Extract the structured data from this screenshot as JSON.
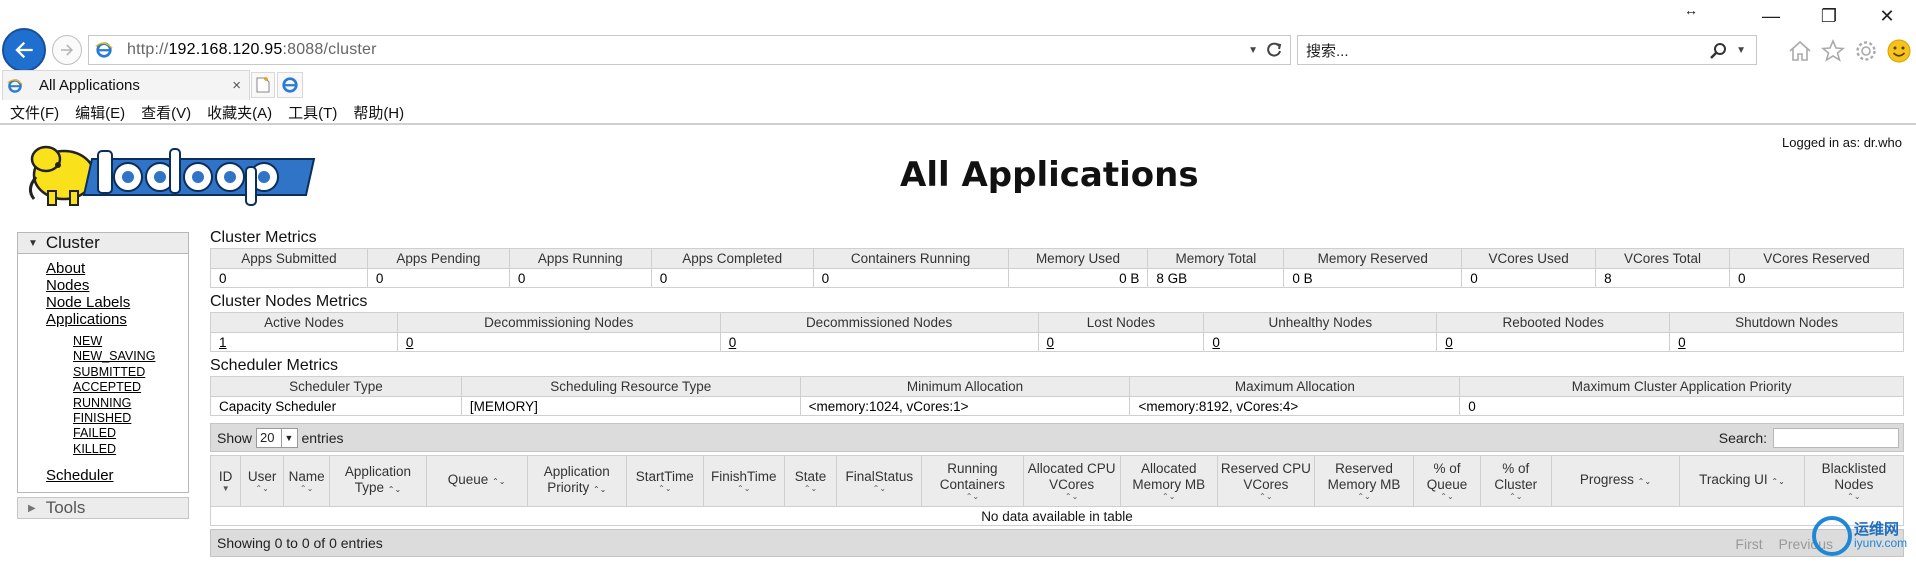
{
  "browser": {
    "url_prefix": "http://",
    "url_host": "192.168.120.95",
    "url_rest": ":8088/cluster",
    "search_placeholder": "搜索...",
    "tab_title": "All Applications",
    "tab_close": "×",
    "menu": [
      "文件(F)",
      "编辑(E)",
      "查看(V)",
      "收藏夹(A)",
      "工具(T)",
      "帮助(H)"
    ],
    "window_controls": {
      "minimize": "—",
      "restore": "❐",
      "close": "✕"
    }
  },
  "header": {
    "logged_in": "Logged in as: dr.who",
    "title": "All Applications"
  },
  "nav": {
    "cluster_label": "Cluster",
    "cluster_links": [
      "About",
      "Nodes",
      "Node Labels",
      "Applications"
    ],
    "app_states": [
      "NEW",
      "NEW_SAVING",
      "SUBMITTED",
      "ACCEPTED",
      "RUNNING",
      "FINISHED",
      "FAILED",
      "KILLED"
    ],
    "scheduler_link": "Scheduler",
    "tools_label": "Tools"
  },
  "cluster_metrics": {
    "title": "Cluster Metrics",
    "headers": [
      "Apps Submitted",
      "Apps Pending",
      "Apps Running",
      "Apps Completed",
      "Containers Running",
      "Memory Used",
      "Memory Total",
      "Memory Reserved",
      "VCores Used",
      "VCores Total",
      "VCores Reserved"
    ],
    "values": [
      "0",
      "0",
      "0",
      "0",
      "0",
      "0 B",
      "8 GB",
      "0 B",
      "0",
      "8",
      "0"
    ]
  },
  "nodes_metrics": {
    "title": "Cluster Nodes Metrics",
    "headers": [
      "Active Nodes",
      "Decommissioning Nodes",
      "Decommissioned Nodes",
      "Lost Nodes",
      "Unhealthy Nodes",
      "Rebooted Nodes",
      "Shutdown Nodes"
    ],
    "values": [
      "1",
      "0",
      "0",
      "0",
      "0",
      "0",
      "0"
    ]
  },
  "scheduler_metrics": {
    "title": "Scheduler Metrics",
    "headers": [
      "Scheduler Type",
      "Scheduling Resource Type",
      "Minimum Allocation",
      "Maximum Allocation",
      "Maximum Cluster Application Priority"
    ],
    "values": [
      "Capacity Scheduler",
      "[MEMORY]",
      "<memory:1024, vCores:1>",
      "<memory:8192, vCores:4>",
      "0"
    ]
  },
  "apps_table": {
    "show_label": "Show",
    "page_size": "20",
    "entries_label": "entries",
    "search_label": "Search:",
    "headers": [
      "ID",
      "User",
      "Name",
      "Application Type",
      "Queue",
      "Application Priority",
      "StartTime",
      "FinishTime",
      "State",
      "FinalStatus",
      "Running Containers",
      "Allocated CPU VCores",
      "Allocated Memory MB",
      "Reserved CPU VCores",
      "Reserved Memory MB",
      "% of Queue",
      "% of Cluster",
      "Progress",
      "Tracking UI",
      "Blacklisted Nodes"
    ],
    "empty_text": "No data available in table",
    "footer_text": "Showing 0 to 0 of 0 entries",
    "pager": [
      "First",
      "Previous"
    ]
  },
  "watermark": {
    "line1": "运维网",
    "line2": "iyunv.com"
  }
}
